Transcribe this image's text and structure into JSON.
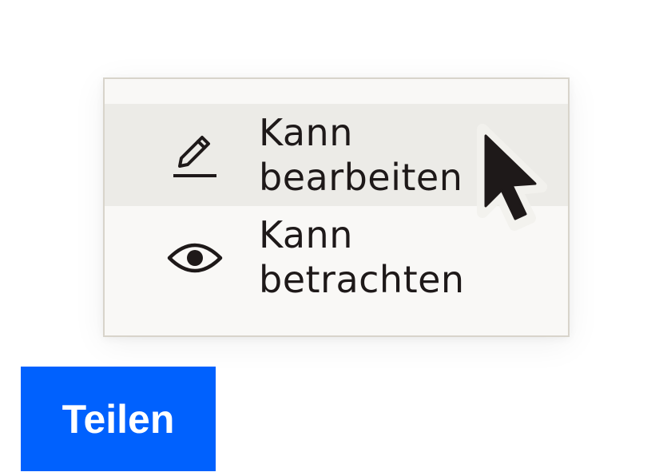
{
  "menu": {
    "items": [
      {
        "icon": "pencil-icon",
        "label_line1": "Kann",
        "label_line2": "bearbeiten",
        "highlighted": true
      },
      {
        "icon": "eye-icon",
        "label_line1": "Kann",
        "label_line2": "betrachten",
        "highlighted": false
      }
    ]
  },
  "share_button": {
    "label": "Teilen"
  },
  "colors": {
    "button_blue": "#0061fe",
    "text": "#1e1919",
    "menu_bg": "#f9f8f6",
    "highlight_bg": "#ecebe7",
    "menu_border": "#d8d4cb"
  }
}
